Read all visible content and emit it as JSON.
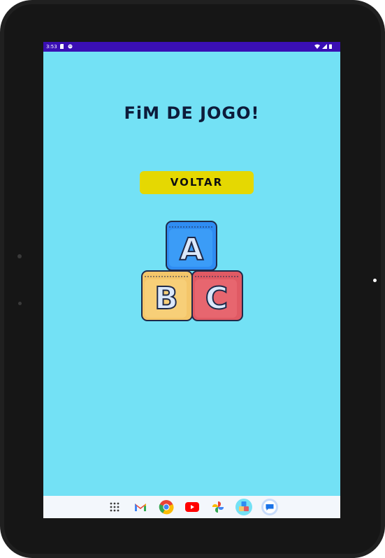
{
  "status_bar": {
    "time": "3:53",
    "icons": [
      "sd-card-icon",
      "notification-icon",
      "wifi-icon",
      "signal-icon",
      "battery-icon"
    ]
  },
  "screen": {
    "title": "FiM DE JOGO!",
    "back_button_label": "VOLTAR",
    "blocks": [
      "A",
      "B",
      "C"
    ]
  },
  "dock": {
    "apps": [
      "app-drawer-icon",
      "gmail-icon",
      "chrome-icon",
      "youtube-icon",
      "photos-icon",
      "abc-app-icon",
      "messages-icon"
    ]
  },
  "colors": {
    "background": "#73e1f5",
    "status_bar": "#3a0fb4",
    "button": "#e5d802",
    "title": "#0d1b3a",
    "block_a": "#2f8cf2",
    "block_b": "#f4c66a",
    "block_c": "#e05a64"
  }
}
